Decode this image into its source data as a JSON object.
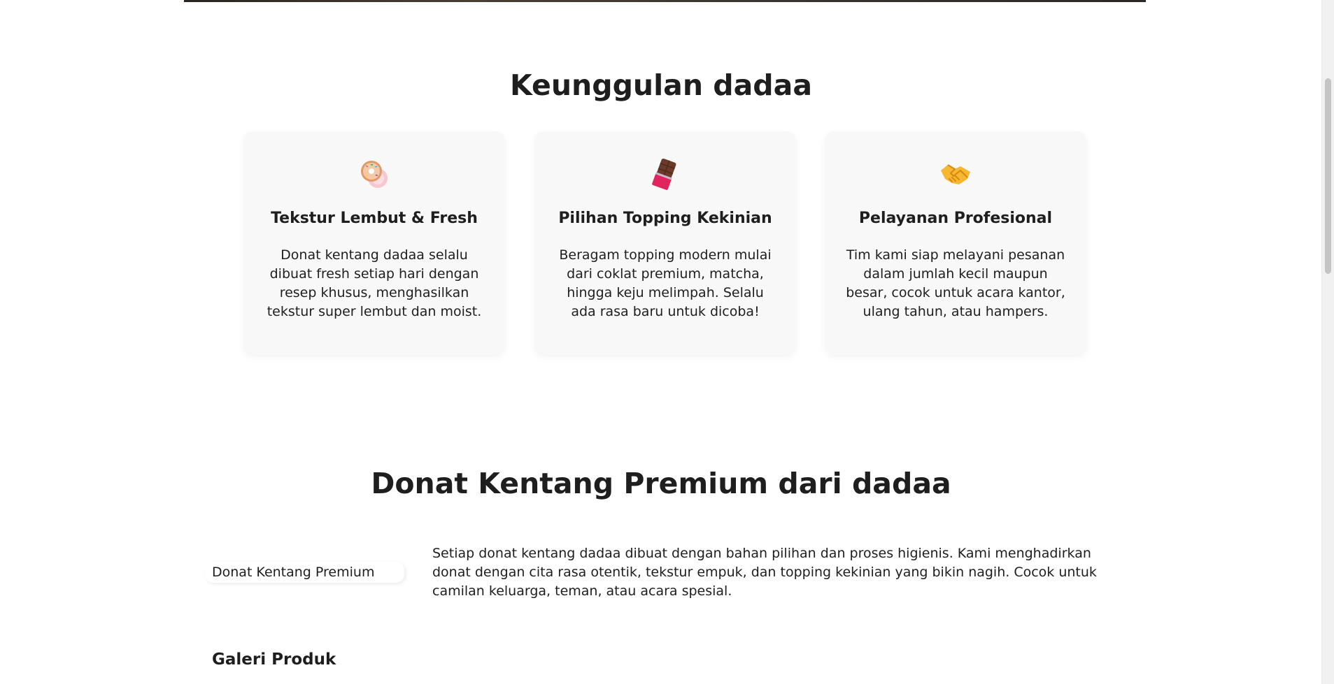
{
  "features": {
    "title": "Keunggulan dadaa",
    "cards": [
      {
        "icon": "donut-icon",
        "title": "Tekstur Lembut & Fresh",
        "text": "Donat kentang dadaa selalu dibuat fresh setiap hari dengan resep khusus, menghasilkan tekstur super lembut dan moist."
      },
      {
        "icon": "chocolate-bar-icon",
        "title": "Pilihan Topping Kekinian",
        "text": "Beragam topping modern mulai dari coklat premium, matcha, hingga keju melimpah. Selalu ada rasa baru untuk dicoba!"
      },
      {
        "icon": "handshake-icon",
        "title": "Pelayanan Profesional",
        "text": "Tim kami siap melayani pesanan dalam jumlah kecil maupun besar, cocok untuk acara kantor, ulang tahun, atau hampers."
      }
    ]
  },
  "premium": {
    "title": "Donat Kentang Premium dari dadaa",
    "product_label": "Donat Kentang Premium",
    "description": "Setiap donat kentang dadaa dibuat dengan bahan pilihan dan proses higienis. Kami menghadirkan donat dengan cita rasa otentik, tekstur empuk, dan topping kekinian yang bikin nagih. Cocok untuk camilan keluarga, teman, atau acara spesial."
  },
  "gallery": {
    "title": "Galeri Produk"
  },
  "colors": {
    "text": "#1e1e1e",
    "card_bg": "#f8f8f8",
    "page_bg": "#ffffff"
  }
}
